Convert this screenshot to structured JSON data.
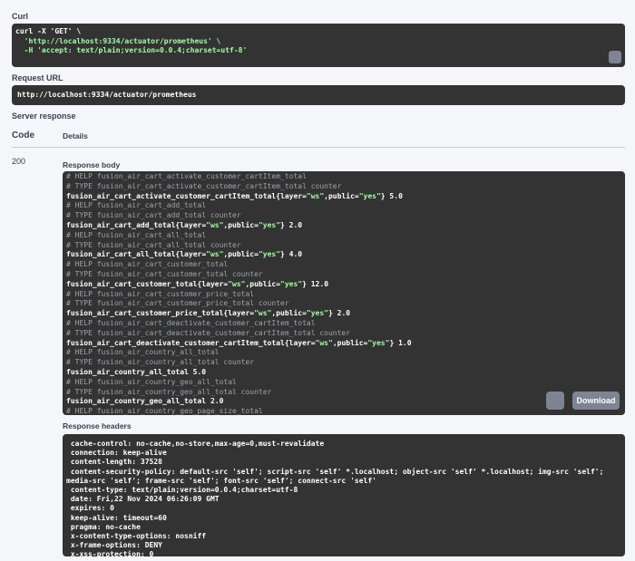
{
  "curl": {
    "label": "Curl",
    "lines": [
      "curl -X 'GET' \\",
      "  'http://localhost:9334/actuator/prometheus' \\",
      "  -H 'accept: text/plain;version=0.0.4;charset=utf-8'"
    ]
  },
  "request_url": {
    "label": "Request URL",
    "value": "http://localhost:9334/actuator/prometheus"
  },
  "server_response": {
    "label": "Server response",
    "col_code": "Code",
    "col_details": "Details",
    "code": "200",
    "body_label": "Response body",
    "download_label": "Download",
    "body_lines": [
      {
        "kind": "c",
        "text": "# HELP fusion_air_cart_activate_customer_cartItem_total"
      },
      {
        "kind": "c",
        "text": "# TYPE fusion_air_cart_activate_customer_cartItem_total counter"
      },
      {
        "kind": "d",
        "metric": "fusion_air_cart_activate_customer_cartItem_total",
        "layer": "ws",
        "public": "yes",
        "value": "5.0"
      },
      {
        "kind": "c",
        "text": "# HELP fusion_air_cart_add_total"
      },
      {
        "kind": "c",
        "text": "# TYPE fusion_air_cart_add_total counter"
      },
      {
        "kind": "d",
        "metric": "fusion_air_cart_add_total",
        "layer": "ws",
        "public": "yes",
        "value": "2.0"
      },
      {
        "kind": "c",
        "text": "# HELP fusion_air_cart_all_total"
      },
      {
        "kind": "c",
        "text": "# TYPE fusion_air_cart_all_total counter"
      },
      {
        "kind": "d",
        "metric": "fusion_air_cart_all_total",
        "layer": "ws",
        "public": "yes",
        "value": "4.0"
      },
      {
        "kind": "c",
        "text": "# HELP fusion_air_cart_customer_total"
      },
      {
        "kind": "c",
        "text": "# TYPE fusion_air_cart_customer_total counter"
      },
      {
        "kind": "d",
        "metric": "fusion_air_cart_customer_total",
        "layer": "ws",
        "public": "yes",
        "value": "12.0"
      },
      {
        "kind": "c",
        "text": "# HELP fusion_air_cart_customer_price_total"
      },
      {
        "kind": "c",
        "text": "# TYPE fusion_air_cart_customer_price_total counter"
      },
      {
        "kind": "d",
        "metric": "fusion_air_cart_customer_price_total",
        "layer": "ws",
        "public": "yes",
        "value": "2.0"
      },
      {
        "kind": "c",
        "text": "# HELP fusion_air_cart_deactivate_customer_cartItem_total"
      },
      {
        "kind": "c",
        "text": "# TYPE fusion_air_cart_deactivate_customer_cartItem_total counter"
      },
      {
        "kind": "d",
        "metric": "fusion_air_cart_deactivate_customer_cartItem_total",
        "layer": "ws",
        "public": "yes",
        "value": "1.0"
      },
      {
        "kind": "c",
        "text": "# HELP fusion_air_country_all_total"
      },
      {
        "kind": "c",
        "text": "# TYPE fusion_air_country_all_total counter"
      },
      {
        "kind": "p",
        "text": "fusion_air_country_all_total 5.0"
      },
      {
        "kind": "c",
        "text": "# HELP fusion_air_country_geo_all_total"
      },
      {
        "kind": "c",
        "text": "# TYPE fusion_air_country_geo_all_total counter"
      },
      {
        "kind": "p",
        "text": "fusion_air_country_geo_all_total 2.0"
      },
      {
        "kind": "c",
        "text": "# HELP fusion_air_country_geo_page_size_total"
      }
    ],
    "headers_label": "Response headers",
    "headers_lines": [
      " cache-control: no-cache,no-store,max-age=0,must-revalidate",
      " connection: keep-alive",
      " content-length: 37528",
      " content-security-policy: default-src 'self'; script-src 'self' *.localhost; object-src 'self' *.localhost; img-src 'self';",
      "media-src 'self'; frame-src 'self'; font-src 'self'; connect-src 'self'",
      " content-type: text/plain;version=0.0.4;charset=utf-8",
      " date: Fri,22 Nov 2024 06:26:09 GMT",
      " expires: 0",
      " keep-alive: timeout=60",
      " pragma: no-cache",
      " x-content-type-options: nosniff",
      " x-frame-options: DENY",
      " x-xss-protection: 0"
    ]
  }
}
